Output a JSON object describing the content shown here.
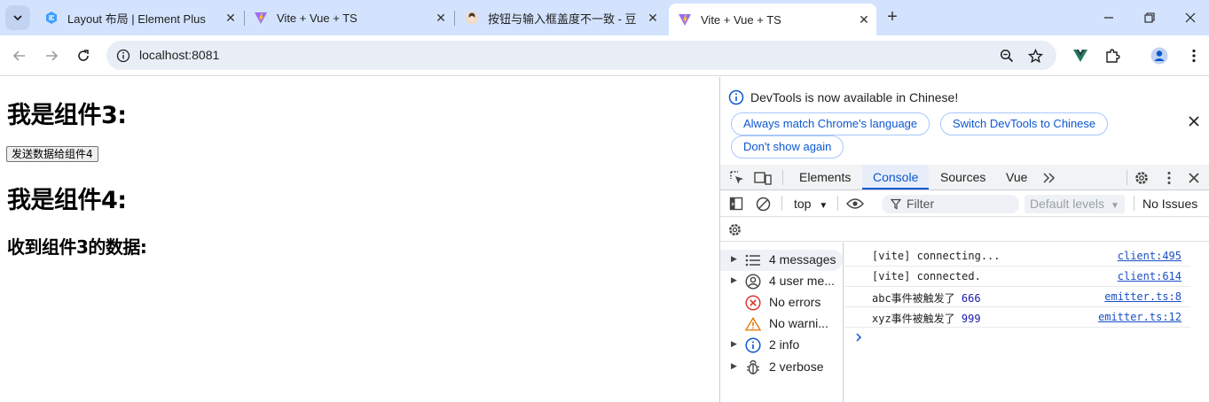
{
  "browser": {
    "tabs": [
      {
        "title": "Layout 布局 | Element Plus",
        "icon": "element-plus-icon",
        "active": false
      },
      {
        "title": "Vite + Vue + TS",
        "icon": "vite-icon",
        "active": false
      },
      {
        "title": "按钮与输入框盖度不一致 - 豆包",
        "icon": "doubao-icon",
        "active": false
      },
      {
        "title": "Vite + Vue + TS",
        "icon": "vite-icon",
        "active": true
      }
    ],
    "url": "localhost:8081"
  },
  "page": {
    "comp3_title": "我是组件3:",
    "send_button": "发送数据给组件4",
    "comp4_title": "我是组件4:",
    "received_label": "收到组件3的数据:"
  },
  "devtools": {
    "banner": {
      "message": "DevTools is now available in Chinese!",
      "btn_match": "Always match Chrome's language",
      "btn_switch": "Switch DevTools to Chinese",
      "btn_dont_show": "Don't show again"
    },
    "tabs": [
      "Elements",
      "Console",
      "Sources",
      "Vue"
    ],
    "active_tab": "Console",
    "context": "top",
    "filter_placeholder": "Filter",
    "levels": "Default levels",
    "issues": "No Issues",
    "sidebar": [
      {
        "label": "4 messages",
        "icon": "list-icon",
        "expandable": true,
        "selected": true
      },
      {
        "label": "4 user me...",
        "icon": "user-icon",
        "expandable": true,
        "selected": false
      },
      {
        "label": "No errors",
        "icon": "error-icon",
        "expandable": false,
        "selected": false
      },
      {
        "label": "No warni...",
        "icon": "warning-icon",
        "expandable": false,
        "selected": false
      },
      {
        "label": "2 info",
        "icon": "info-icon",
        "expandable": true,
        "selected": false
      },
      {
        "label": "2 verbose",
        "icon": "bug-icon",
        "expandable": true,
        "selected": false
      }
    ],
    "logs": [
      {
        "text": "[vite] connecting...",
        "num": "",
        "source": "client:495"
      },
      {
        "text": "[vite] connected.",
        "num": "",
        "source": "client:614"
      },
      {
        "text": "abc事件被触发了",
        "num": "666",
        "source": "emitter.ts:8"
      },
      {
        "text": "xyz事件被触发了",
        "num": "999",
        "source": "emitter.ts:12"
      }
    ]
  },
  "colors": {
    "accent": "#0b57d0",
    "tabstrip": "#d3e3fd",
    "omnibox": "#e9eef6"
  }
}
